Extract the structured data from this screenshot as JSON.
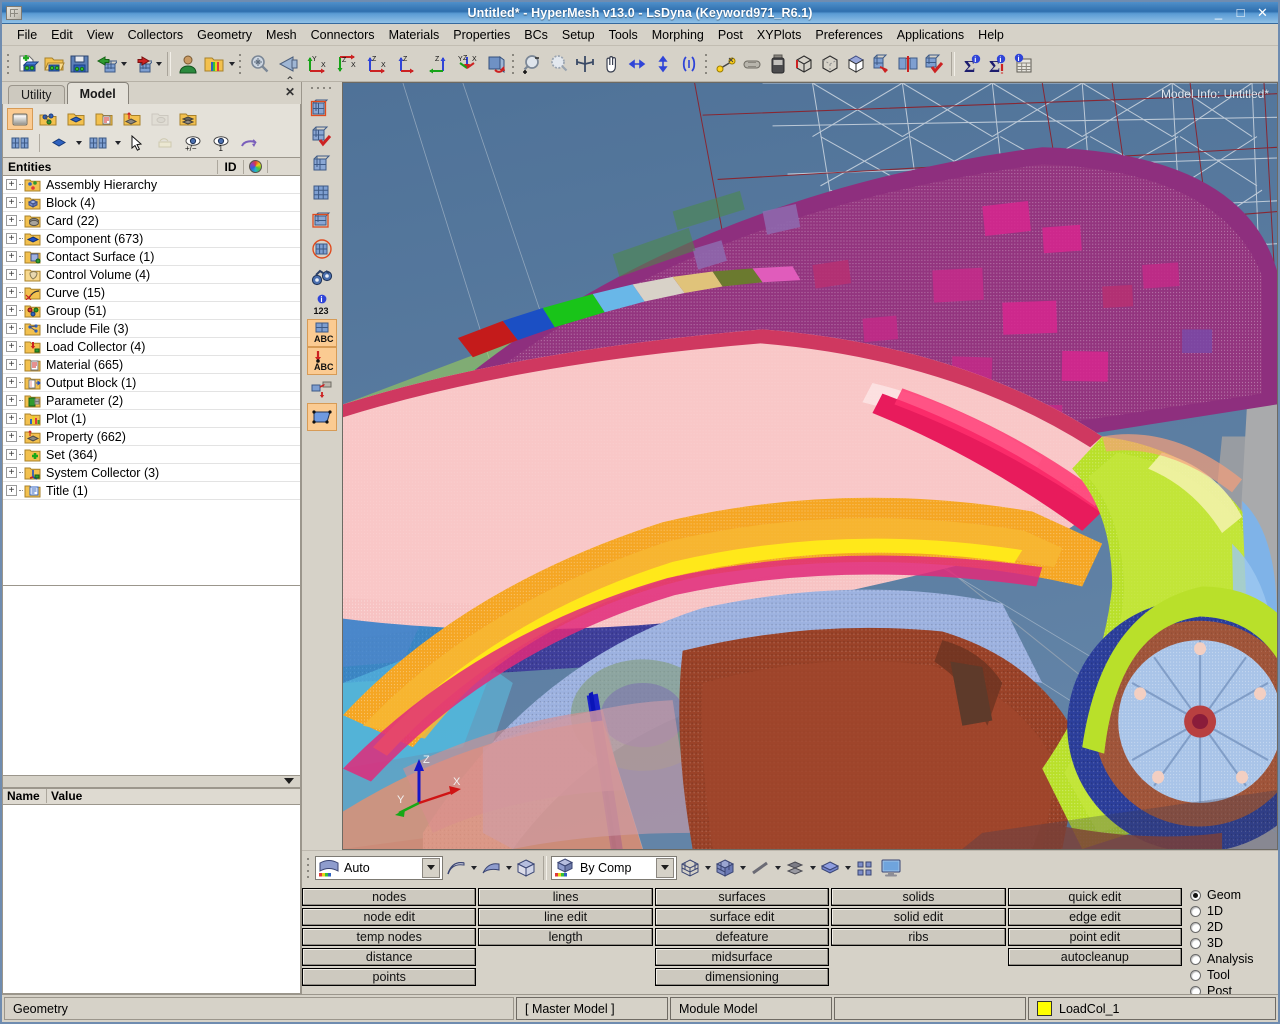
{
  "window": {
    "title": "Untitled* - HyperMesh v13.0 - LsDyna (Keyword971_R6.1)",
    "minimize": "_",
    "maximize": "□",
    "close": "✕"
  },
  "menubar": [
    {
      "label": "File"
    },
    {
      "label": "Edit"
    },
    {
      "label": "View"
    },
    {
      "label": "Collectors"
    },
    {
      "label": "Geometry"
    },
    {
      "label": "Mesh"
    },
    {
      "label": "Connectors"
    },
    {
      "label": "Materials"
    },
    {
      "label": "Properties"
    },
    {
      "label": "BCs"
    },
    {
      "label": "Setup"
    },
    {
      "label": "Tools"
    },
    {
      "label": "Morphing"
    },
    {
      "label": "Post"
    },
    {
      "label": "XYPlots"
    },
    {
      "label": "Preferences"
    },
    {
      "label": "Applications"
    },
    {
      "label": "Help"
    }
  ],
  "toolbar": {
    "groups": [
      [
        "new-model-icon",
        "open-model-icon",
        "save-model-icon",
        "import-icon",
        "export-icon",
        "session-user-icon",
        "load-results-icon"
      ],
      [
        "fit-view-icon",
        "back-view-icon",
        "xy-top-view-icon",
        "yx-view-icon",
        "zx-view-icon",
        "zy-view-icon",
        "yz-view-icon",
        "iso-view-icon",
        "rotate-view-icon"
      ],
      [
        "zoom-out-icon",
        "zoom-window-icon",
        "fit-icon",
        "pan-icon",
        "arrow-lr-icon",
        "arrow-ud-icon",
        "mirror-icon"
      ],
      [
        "distance-node-icon",
        "mass-icon",
        "container-icon"
      ],
      [
        "wireframe-cube-icon",
        "hidden-line-cube-icon",
        "shaded-cube-icon",
        "shrink-mesh-icon",
        "mesh-lines-icon",
        "mesh-check-icon"
      ],
      [
        "summary-icon",
        "summary-sort-icon",
        "matrix-browser-icon"
      ]
    ]
  },
  "left_panel": {
    "tabs": [
      {
        "label": "Utility",
        "active": false
      },
      {
        "label": "Model",
        "active": true
      }
    ],
    "close_label": "✕",
    "collapse_label": "⌃",
    "tree_toolbar_row1": [
      "component-folder-icon",
      "assembly-icon",
      "component-blue-icon",
      "material-folder-icon",
      "property-folder-icon",
      "contact-folder-icon",
      "stack-folder-icon"
    ],
    "tree_toolbar_row2": [
      "elements-mesh-icon",
      "display-blue-icon",
      "mesh-display-icon",
      "cursor-arrow-icon",
      "isolate-icon",
      "eye-plusminus-icon",
      "eye-one-icon",
      "reverse-icon"
    ],
    "entities_header": {
      "name": "Entities",
      "id": "ID",
      "color": "color-wheel-icon"
    },
    "tree_items": [
      {
        "label": "Assembly Hierarchy",
        "icon": "assembly-hierarchy-icon"
      },
      {
        "label": "Block (4)",
        "icon": "block-icon"
      },
      {
        "label": "Card (22)",
        "icon": "card-icon"
      },
      {
        "label": "Component (673)",
        "icon": "component-icon"
      },
      {
        "label": "Contact Surface (1)",
        "icon": "contact-surface-icon"
      },
      {
        "label": "Control Volume (4)",
        "icon": "control-volume-icon"
      },
      {
        "label": "Curve (15)",
        "icon": "curve-icon"
      },
      {
        "label": "Group (51)",
        "icon": "group-icon"
      },
      {
        "label": "Include File (3)",
        "icon": "include-file-icon"
      },
      {
        "label": "Load Collector (4)",
        "icon": "load-collector-icon"
      },
      {
        "label": "Material (665)",
        "icon": "material-icon"
      },
      {
        "label": "Output Block (1)",
        "icon": "output-block-icon"
      },
      {
        "label": "Parameter (2)",
        "icon": "parameter-icon"
      },
      {
        "label": "Plot (1)",
        "icon": "plot-icon"
      },
      {
        "label": "Property (662)",
        "icon": "property-icon"
      },
      {
        "label": "Set (364)",
        "icon": "set-icon"
      },
      {
        "label": "System Collector (3)",
        "icon": "system-collector-icon"
      },
      {
        "label": "Title (1)",
        "icon": "title-icon"
      }
    ],
    "expander_symbol": "+",
    "name_value": {
      "name_header": "Name",
      "value_header": "Value",
      "rows": []
    }
  },
  "view_toolbar": [
    "mesh-highlight-icon",
    "mesh-check-icon",
    "mesh-plain-icon",
    "mesh-grid-icon",
    "mesh-box-icon",
    "mesh-circle-icon",
    "binoculars-icon",
    "info-123-icon",
    "mesh-abc-icon",
    "load-abc-icon",
    "translate-mesh-icon",
    "surface-blue-icon"
  ],
  "viewport": {
    "model_info": "Model Info: Untitled*",
    "axis_labels": {
      "x": "X",
      "y": "Y",
      "z": "Z"
    },
    "background_color": "#5b7fa3"
  },
  "bottom_toolbar": {
    "mesh_mode_combo": {
      "value": "Auto",
      "icon": "mesh-auto-icon"
    },
    "geom_icons": [
      "surface-edge-icon",
      "surface-shade-icon",
      "solid-cube-icon"
    ],
    "color_mode_combo": {
      "value": "By Comp",
      "icon": "color-cube-icon"
    },
    "display_icons": [
      "wire-cube-icon",
      "shaded-cube-icon",
      "line-icon",
      "shrink-icon",
      "blue-surface-icon",
      "panels-icon",
      "monitor-icon"
    ]
  },
  "command_panel": {
    "columns": [
      [
        "nodes",
        "node edit",
        "temp nodes",
        "distance",
        "points"
      ],
      [
        "lines",
        "line edit",
        "length",
        "",
        ""
      ],
      [
        "surfaces",
        "surface edit",
        "defeature",
        "midsurface",
        "dimensioning"
      ],
      [
        "solids",
        "solid edit",
        "ribs",
        "",
        ""
      ],
      [
        "quick edit",
        "edge edit",
        "point edit",
        "autocleanup",
        ""
      ]
    ],
    "modes": [
      {
        "label": "Geom",
        "selected": true
      },
      {
        "label": "1D",
        "selected": false
      },
      {
        "label": "2D",
        "selected": false
      },
      {
        "label": "3D",
        "selected": false
      },
      {
        "label": "Analysis",
        "selected": false
      },
      {
        "label": "Tool",
        "selected": false
      },
      {
        "label": "Post",
        "selected": false
      }
    ]
  },
  "statusbar": {
    "message": "Geometry",
    "master_model": "[ Master Model ]",
    "module_model": "Module Model",
    "blank": "",
    "load_collector": "LoadCol_1",
    "load_collector_color": "#ffff00"
  }
}
